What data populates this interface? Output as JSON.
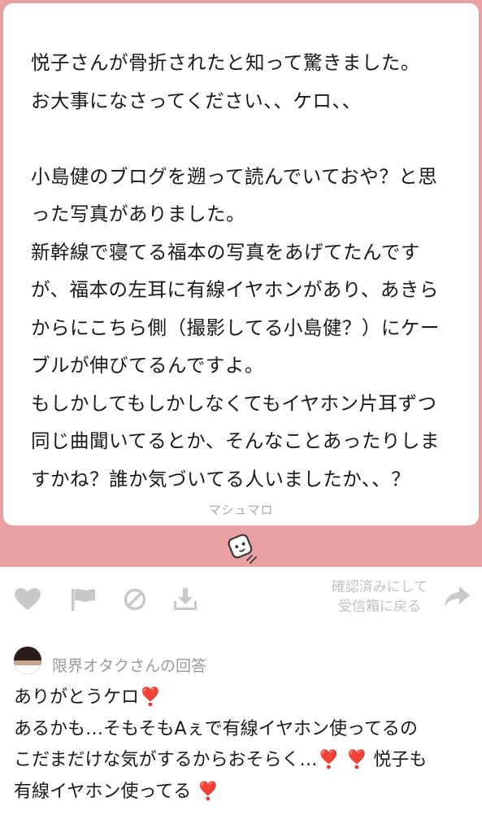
{
  "question": {
    "lines": [
      "悦子さんが骨折されたと知って驚きました。",
      "お大事になさってください、、ケロ、、",
      "",
      "小島健のブログを遡って読んでいておや？と思",
      "った写真がありました。",
      "新幹線で寝てる福本の写真をあげてたんです",
      "が、福本の左耳に有線イヤホンがあり、あきら",
      "からにこちら側（撮影してる小島健？）にケー",
      "ブルが伸びてるんですよ。",
      "もしかしてもしかしなくてもイヤホン片耳ずつ",
      "同じ曲聞いてるとか、そんなことあったりしま",
      "すかね？誰か気づいてる人いましたか、、？"
    ]
  },
  "brand_label": "マシュマロ",
  "actions": {
    "restore_label_line1": "確認済みにして",
    "restore_label_line2": "受信箱に戻る"
  },
  "answer": {
    "title": "限界オタクさんの回答",
    "line1_text": "ありがとうケロ",
    "line2_text": "あるかも…そもそもAぇで有線イヤホン使ってるの",
    "line3_text": "こだまだけな気がするからおそらく…",
    "line3_tail": "悦子も",
    "line4_text": "有線イヤホン使ってる",
    "bang": "❣️"
  },
  "colors": {
    "pink": "#e8a0a3",
    "icon_gray": "#c8c8c8",
    "accent_red": "#e0242f"
  }
}
